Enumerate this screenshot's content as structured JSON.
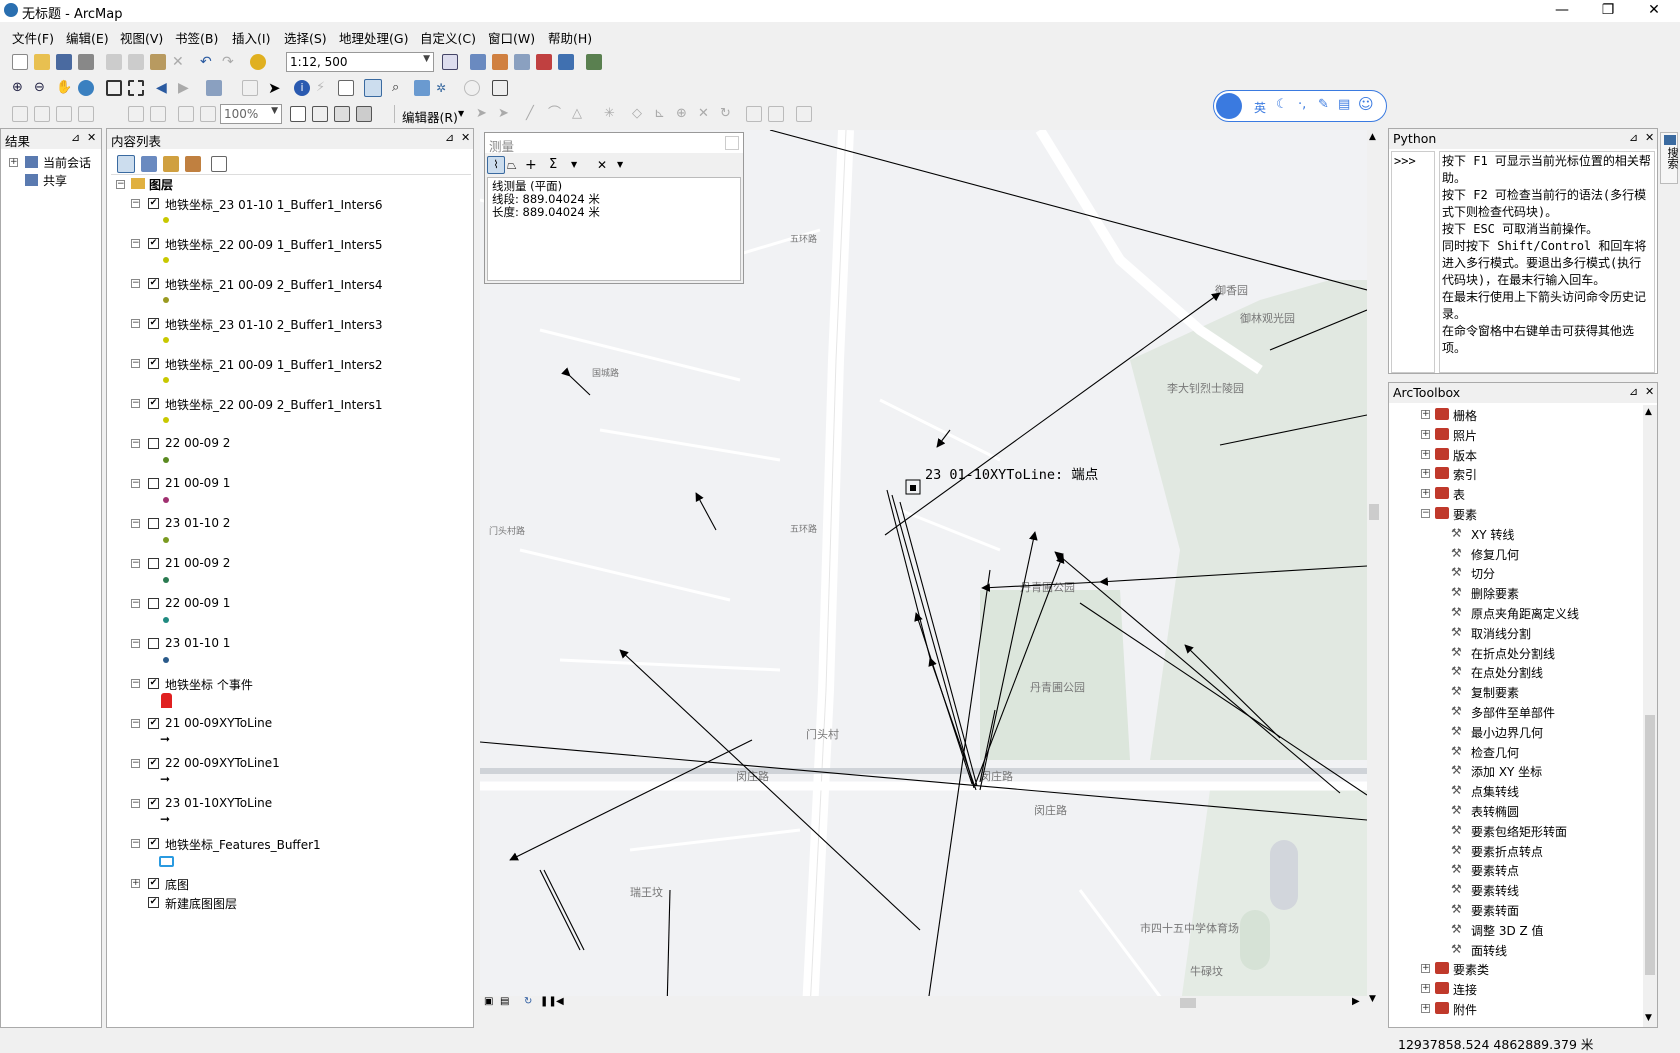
{
  "window": {
    "title": "无标题 - ArcMap",
    "min": "—",
    "max": "❐",
    "close": "✕"
  },
  "menu": [
    "文件(F)",
    "编辑(E)",
    "视图(V)",
    "书签(B)",
    "插入(I)",
    "选择(S)",
    "地理处理(G)",
    "自定义(C)",
    "窗口(W)",
    "帮助(H)"
  ],
  "toolbar": {
    "scale": "1:12, 500",
    "zoom": "100%",
    "editor": "编辑器(R)"
  },
  "ime": {
    "lang": "英"
  },
  "results": {
    "title": "结果",
    "items": [
      "当前会话",
      "共享"
    ]
  },
  "toc": {
    "title": "内容列表",
    "root": "图层",
    "layers": [
      {
        "name": "地铁坐标_23 01-10 1_Buffer1_Inters6",
        "checked": true,
        "sym": "#c8c800"
      },
      {
        "name": "地铁坐标_22 00-09 1_Buffer1_Inters5",
        "checked": true,
        "sym": "#c8c800"
      },
      {
        "name": "地铁坐标_21 00-09 2_Buffer1_Inters4",
        "checked": true,
        "sym": "#9a9a20"
      },
      {
        "name": "地铁坐标_23 01-10 2_Buffer1_Inters3",
        "checked": true,
        "sym": "#c8c800"
      },
      {
        "name": "地铁坐标_21 00-09 1_Buffer1_Inters2",
        "checked": true,
        "sym": "#c8c800"
      },
      {
        "name": "地铁坐标_22 00-09 2_Buffer1_Inters1",
        "checked": true,
        "sym": "#c8c800"
      },
      {
        "name": "22 00-09 2",
        "checked": false,
        "sym": "#5a8a20"
      },
      {
        "name": "21 00-09 1",
        "checked": false,
        "sym": "#a03070"
      },
      {
        "name": "23 01-10 2",
        "checked": false,
        "sym": "#7a9a20"
      },
      {
        "name": "21 00-09 2",
        "checked": false,
        "sym": "#2a7a50"
      },
      {
        "name": "22 00-09 1",
        "checked": false,
        "sym": "#208a80"
      },
      {
        "name": "23 01-10 1",
        "checked": false,
        "sym": "#2a5a8a"
      },
      {
        "name": "地铁坐标 个事件",
        "checked": true,
        "sym": "train"
      },
      {
        "name": "21 00-09XYToLine",
        "checked": true,
        "sym": "arrow"
      },
      {
        "name": "22 00-09XYToLine1",
        "checked": true,
        "sym": "arrow"
      },
      {
        "name": "23 01-10XYToLine",
        "checked": true,
        "sym": "arrow"
      },
      {
        "name": "地铁坐标_Features_Buffer1",
        "checked": true,
        "sym": "poly"
      }
    ],
    "basemap": "底图",
    "newbasemap": "新建底图图层"
  },
  "measure": {
    "title": "测量",
    "lines": [
      "线测量 (平面)",
      "线段: 889.04024 米",
      "长度: 889.04024 米"
    ]
  },
  "map": {
    "label": "23 01-10XYToLine: 端点",
    "places": [
      "御香园",
      "御林观光园",
      "李大钊烈士陵园",
      "丹青圃公园",
      "丹青圃公园",
      "门头村",
      "闵庄路",
      "闵庄路",
      "闵庄路",
      "市四十五中学体育场",
      "牛碌坟",
      "瑞王坟",
      "五环路",
      "五环路",
      "国城路",
      "门头村路"
    ]
  },
  "python": {
    "title": "Python",
    "prompt": ">>>",
    "lines": [
      "按下 F1 可显示当前光标位置的相关帮助。",
      "按下 F2 可检查当前行的语法(多行模式下则检查代码块)。",
      "按下 ESC 可取消当前操作。",
      "同时按下 Shift/Control 和回车将进入多行模式。要退出多行模式(执行代码块)，在最末行输入回车。",
      "在最末行使用上下箭头访问命令历史记录。",
      "在命令窗格中右键单击可获得其他选项。"
    ]
  },
  "toolbox": {
    "title": "ArcToolbox",
    "items": [
      {
        "label": "栅格",
        "type": "box",
        "exp": "+"
      },
      {
        "label": "照片",
        "type": "box",
        "exp": "+"
      },
      {
        "label": "版本",
        "type": "box",
        "exp": "+"
      },
      {
        "label": "索引",
        "type": "box",
        "exp": "+"
      },
      {
        "label": "表",
        "type": "box",
        "exp": "+"
      },
      {
        "label": "要素",
        "type": "box",
        "exp": "−"
      },
      {
        "label": "XY 转线",
        "type": "tool"
      },
      {
        "label": "修复几何",
        "type": "tool"
      },
      {
        "label": "切分",
        "type": "tool"
      },
      {
        "label": "删除要素",
        "type": "tool"
      },
      {
        "label": "原点夹角距离定义线",
        "type": "tool"
      },
      {
        "label": "取消线分割",
        "type": "tool"
      },
      {
        "label": "在折点处分割线",
        "type": "tool"
      },
      {
        "label": "在点处分割线",
        "type": "tool"
      },
      {
        "label": "复制要素",
        "type": "tool"
      },
      {
        "label": "多部件至单部件",
        "type": "tool"
      },
      {
        "label": "最小边界几何",
        "type": "tool"
      },
      {
        "label": "检查几何",
        "type": "tool"
      },
      {
        "label": "添加 XY 坐标",
        "type": "tool"
      },
      {
        "label": "点集转线",
        "type": "tool"
      },
      {
        "label": "表转椭圆",
        "type": "tool"
      },
      {
        "label": "要素包络矩形转面",
        "type": "tool"
      },
      {
        "label": "要素折点转点",
        "type": "tool"
      },
      {
        "label": "要素转点",
        "type": "tool"
      },
      {
        "label": "要素转线",
        "type": "tool"
      },
      {
        "label": "要素转面",
        "type": "tool"
      },
      {
        "label": "调整 3D Z 值",
        "type": "tool"
      },
      {
        "label": "面转线",
        "type": "tool"
      },
      {
        "label": "要素类",
        "type": "box",
        "exp": "+"
      },
      {
        "label": "连接",
        "type": "box",
        "exp": "+"
      },
      {
        "label": "附件",
        "type": "box",
        "exp": "+"
      }
    ]
  },
  "side_tab": "搜索",
  "status": {
    "coords": "12937858.524  4862889.379 米"
  }
}
